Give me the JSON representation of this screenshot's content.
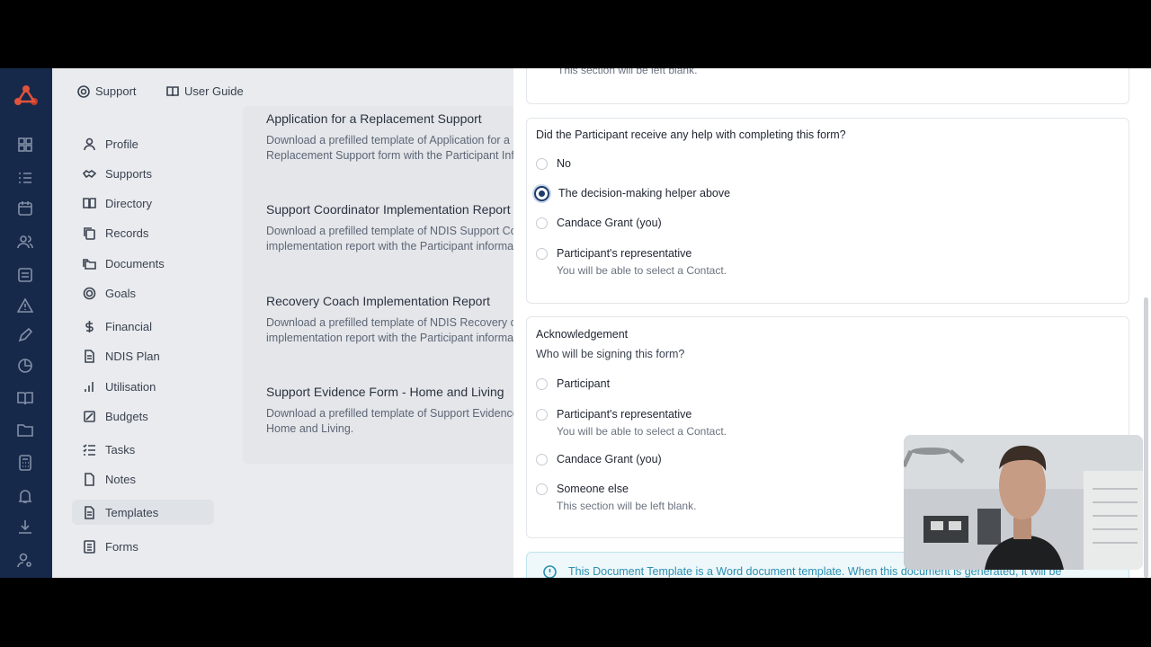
{
  "topbar": {
    "support_label": "Support",
    "user_guide_label": "User Guide"
  },
  "sidenav": {
    "items": [
      {
        "label": "Profile",
        "icon": "person-icon"
      },
      {
        "label": "Supports",
        "icon": "handshake-icon"
      },
      {
        "label": "Directory",
        "icon": "book-icon"
      },
      {
        "label": "Records",
        "icon": "copy-icon"
      },
      {
        "label": "Documents",
        "icon": "folders-icon"
      },
      {
        "label": "Goals",
        "icon": "target-icon"
      },
      {
        "label": "Financial",
        "icon": "dollar-icon"
      },
      {
        "label": "NDIS Plan",
        "icon": "document-icon"
      },
      {
        "label": "Utilisation",
        "icon": "bar-chart-icon"
      },
      {
        "label": "Budgets",
        "icon": "budget-icon"
      },
      {
        "label": "Tasks",
        "icon": "checklist-icon"
      },
      {
        "label": "Notes",
        "icon": "note-icon"
      },
      {
        "label": "Templates",
        "icon": "template-icon",
        "active": true
      },
      {
        "label": "Forms",
        "icon": "form-icon"
      }
    ]
  },
  "templates": [
    {
      "title": "Application for a Replacement Support",
      "desc1": "Download a prefilled template of Application for a",
      "desc2": "Replacement Support form with the Participant Info"
    },
    {
      "title": "Support Coordinator Implementation Report",
      "desc1": "Download a prefilled template of NDIS Support Coo",
      "desc2": "implementation report with the Participant informati"
    },
    {
      "title": "Recovery Coach Implementation Report",
      "desc1": "Download a prefilled template of NDIS Recovery co",
      "desc2": "implementation report with the Participant informati"
    },
    {
      "title": "Support Evidence Form - Home and Living",
      "desc1": "Download a prefilled template of Support Evidence",
      "desc2": "Home and Living."
    }
  ],
  "panel": {
    "top_note": "This section will be left blank.",
    "help_question": "Did the Participant receive any help with completing this form?",
    "help_options": [
      {
        "label": "No",
        "sub": "",
        "selected": false
      },
      {
        "label": "The decision-making helper above",
        "sub": "",
        "selected": true
      },
      {
        "label": "Candace Grant (you)",
        "sub": "",
        "selected": false
      },
      {
        "label": "Participant's representative",
        "sub": "You will be able to select a Contact.",
        "selected": false
      }
    ],
    "ack_title": "Acknowledgement",
    "ack_question": "Who will be signing this form?",
    "ack_options": [
      {
        "label": "Participant",
        "sub": "",
        "selected": false
      },
      {
        "label": "Participant's representative",
        "sub": "You will be able to select a Contact.",
        "selected": false
      },
      {
        "label": "Candace Grant (you)",
        "sub": "",
        "selected": false
      },
      {
        "label": "Someone else",
        "sub": "This section will be left blank.",
        "selected": false
      }
    ],
    "info_text": "This Document Template is a Word document template. When this document is generated, it will be"
  },
  "colors": {
    "rail": "#17294a",
    "accent": "#1c3c6a",
    "info": "#2a8fb0"
  }
}
